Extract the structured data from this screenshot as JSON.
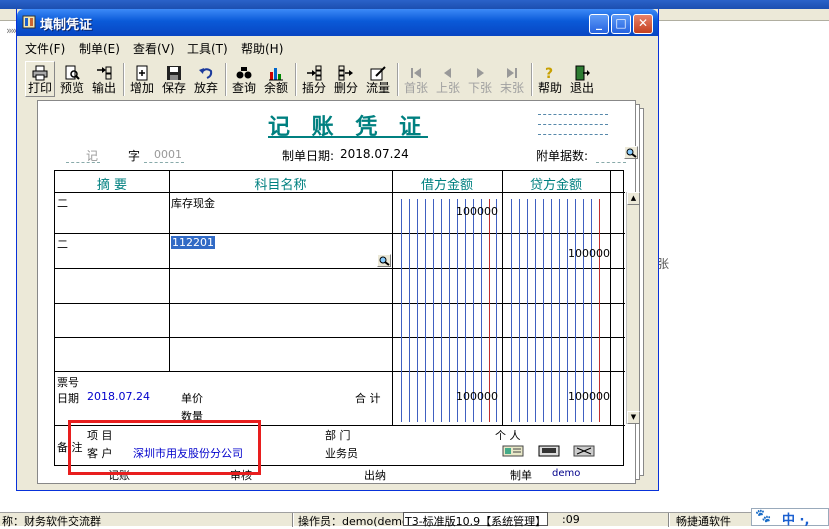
{
  "background": {
    "chevron": "»»",
    "status_left": "称：财务软件交流群",
    "status_operator": "操作员：demo(demo",
    "status_version": "T3-标准版10.9【系统管理】",
    "status_time": ":09",
    "status_right": "畅捷通软件",
    "ime_text": "中 ·,",
    "side_fragment": "张"
  },
  "window": {
    "title": "填制凭证",
    "controls": {
      "minimize": "_",
      "maximize": "□",
      "close": "✕"
    }
  },
  "menu": [
    "文件(F)",
    "制单(E)",
    "查看(V)",
    "工具(T)",
    "帮助(H)"
  ],
  "toolbar": {
    "print": "打印",
    "preview": "预览",
    "export": "输出",
    "add": "增加",
    "save": "保存",
    "discard": "放弃",
    "query": "查询",
    "balance": "余额",
    "insert": "插分",
    "delete": "删分",
    "flow": "流量",
    "first": "首张",
    "prev": "上张",
    "next": "下张",
    "last": "末张",
    "help": "帮助",
    "exit": "退出"
  },
  "voucher": {
    "title": "记 账 凭 证",
    "type_char": "记",
    "zi_label": "字",
    "number": "0001",
    "date_label": "制单日期:",
    "date": "2018.07.24",
    "attachments_label": "附单据数:",
    "headers": {
      "summary": "摘 要",
      "account": "科目名称",
      "debit": "借方金额",
      "credit": "贷方金额"
    },
    "rows": [
      {
        "summary": "二",
        "account": "库存现金",
        "debit": "100000",
        "credit": ""
      },
      {
        "summary": "二",
        "account": "112201",
        "debit": "",
        "credit": "100000"
      }
    ],
    "footer": {
      "ticket_label": "票号",
      "date_label": "日期",
      "date": "2018.07.24",
      "unit_price_label": "单价",
      "quantity_label": "数量",
      "total_label": "合 计",
      "total_debit": "100000",
      "total_credit": "100000"
    },
    "remarks": {
      "note_label": "备 注",
      "project_label": "项 目",
      "customer_label": "客 户",
      "customer": "深圳市用友股份分公司",
      "department_label": "部 门",
      "person_label": "个 人",
      "salesperson_label": "业务员"
    },
    "signatures": {
      "bookkeeper": "记账",
      "reviewer": "审核",
      "cashier": "出纳",
      "maker_label": "制单",
      "maker": "demo"
    }
  },
  "colors": {
    "title_teal": "#008080",
    "highlight_red": "#e81e1e",
    "selection_blue": "#316ac5",
    "xp_titlebar": "#0a5ad8"
  }
}
